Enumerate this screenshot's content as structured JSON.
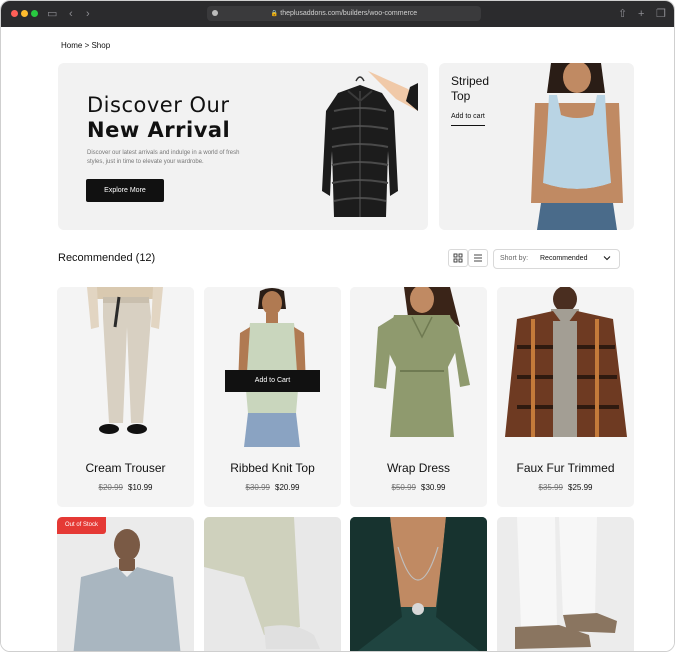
{
  "browser": {
    "url": "theplusaddons.com/builders/woo-commerce"
  },
  "breadcrumb": "Home > Shop",
  "hero": {
    "title_line1": "Discover Our",
    "title_line2": "New Arrival",
    "description": "Discover our latest arrivals and indulge in a world of fresh styles, just in time to elevate your wardrobe.",
    "button": "Explore More"
  },
  "side_promo": {
    "title": "Striped Top",
    "link": "Add to cart"
  },
  "toolbar": {
    "heading": "Recommended (12)",
    "sort_label": "Short by:",
    "sort_value": "Recommended"
  },
  "products": [
    {
      "name": "Cream Trouser",
      "old_price": "$20.99",
      "price": "$10.99"
    },
    {
      "name": "Ribbed Knit Top",
      "old_price": "$30.99",
      "price": "$20.99",
      "hover_button": "Add to Cart"
    },
    {
      "name": "Wrap Dress",
      "old_price": "$50.99",
      "price": "$30.99"
    },
    {
      "name": "Faux Fur Trimmed",
      "old_price": "$35.99",
      "price": "$25.99"
    }
  ],
  "second_row": {
    "badge": "Out of Stock"
  },
  "colors": {
    "accent_dark": "#111111",
    "card_bg": "#f4f4f4",
    "badge_red": "#e53935"
  }
}
